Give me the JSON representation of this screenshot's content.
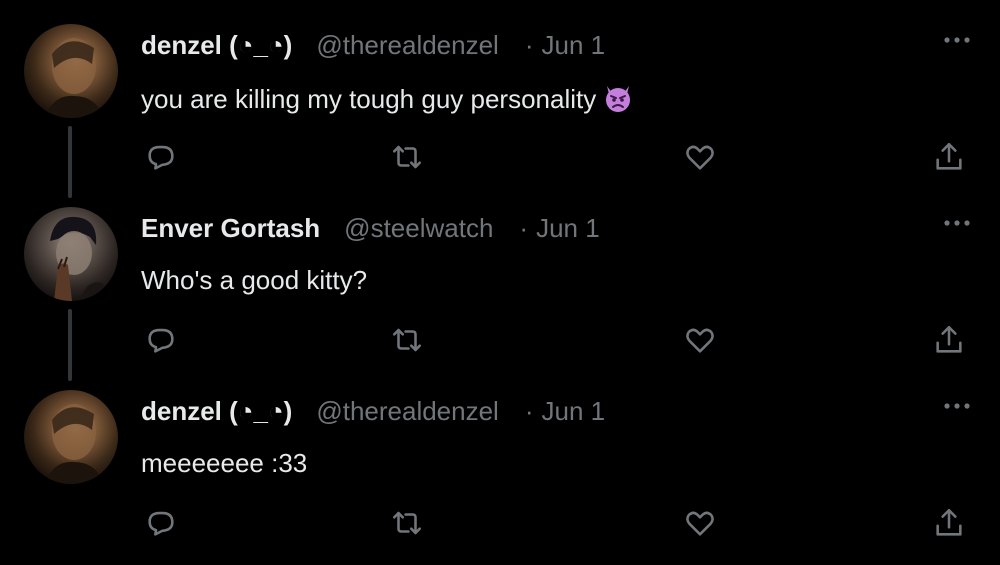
{
  "tweets": [
    {
      "display_name": "denzel (◔_◔)",
      "handle": "@therealdenzel",
      "separator": "·",
      "date": "Jun 1",
      "text": "you are killing my tough guy personality",
      "emoji_icon": "smiling-face-with-horns-icon",
      "avatar_icon": "denzel-avatar"
    },
    {
      "display_name": "Enver Gortash",
      "handle": "@steelwatch",
      "separator": "·",
      "date": "Jun 1",
      "text": "Who's a good kitty?",
      "avatar_icon": "enver-gortash-avatar"
    },
    {
      "display_name": "denzel (◔_◔)",
      "handle": "@therealdenzel",
      "separator": "·",
      "date": "Jun 1",
      "text": "meeeeeee :33",
      "avatar_icon": "denzel-avatar"
    }
  ],
  "icons": {
    "reply": "reply-icon",
    "retweet": "retweet-icon",
    "like": "heart-icon",
    "share": "share-icon",
    "more": "more-options-icon"
  },
  "colors": {
    "background": "#000000",
    "text": "#e7e9ea",
    "secondary": "#71767b",
    "thread_line": "#333639",
    "emoji": "#c47fdc"
  }
}
